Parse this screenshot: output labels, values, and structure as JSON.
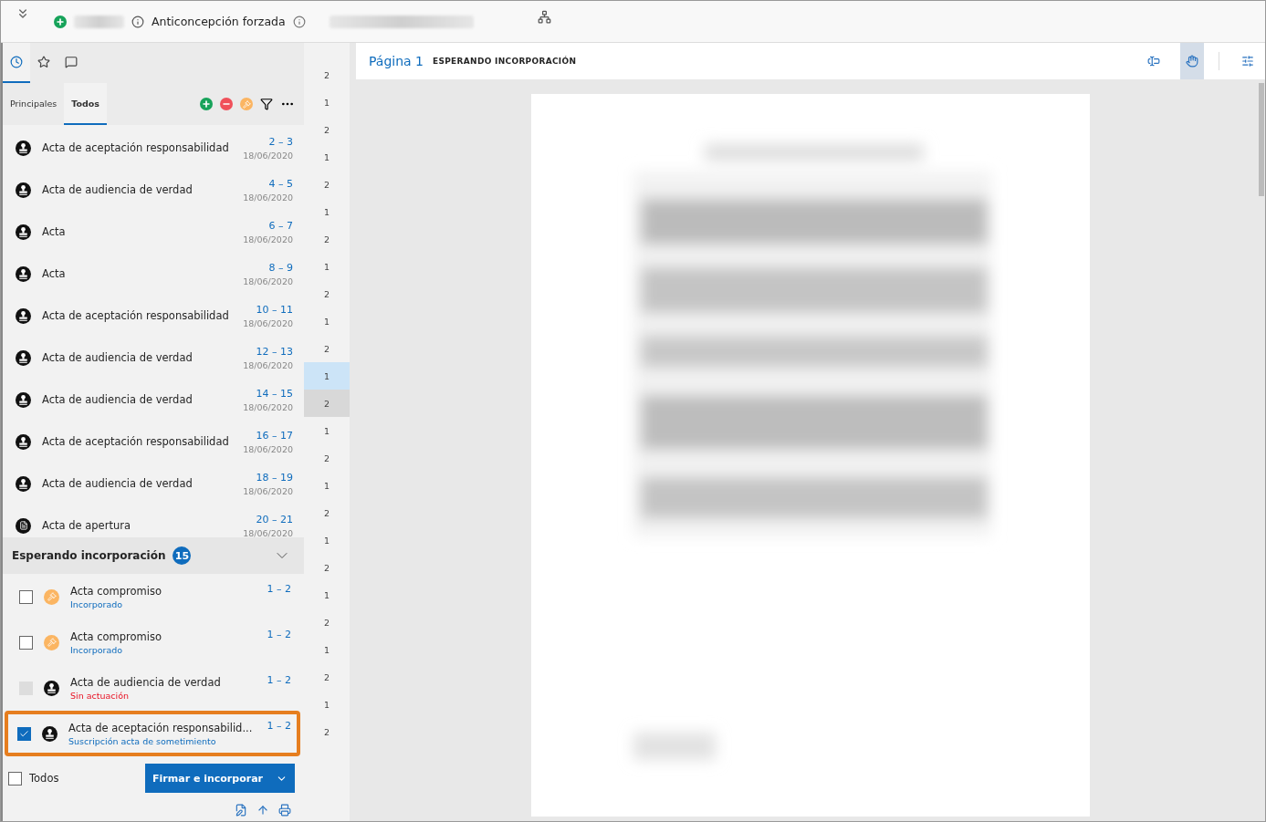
{
  "header": {
    "title": "Anticoncepción forzada"
  },
  "icon_tabs": [
    {
      "kind": "clock",
      "selected": true
    },
    {
      "kind": "star",
      "selected": false
    },
    {
      "kind": "comments",
      "selected": false
    }
  ],
  "sub_tabs": [
    {
      "label": "Principales",
      "selected": false
    },
    {
      "label": "Todos",
      "selected": true
    }
  ],
  "documents": [
    {
      "kind": "stamp",
      "title": "Acta de aceptación responsabilidad",
      "range": "2 – 3",
      "date": "18/06/2020"
    },
    {
      "kind": "stamp",
      "title": "Acta de audiencia de verdad",
      "range": "4 – 5",
      "date": "18/06/2020"
    },
    {
      "kind": "stamp",
      "title": "Acta",
      "range": "6 – 7",
      "date": "18/06/2020"
    },
    {
      "kind": "stamp",
      "title": "Acta",
      "range": "8 – 9",
      "date": "18/06/2020"
    },
    {
      "kind": "stamp",
      "title": "Acta de aceptación responsabilidad",
      "range": "10 – 11",
      "date": "18/06/2020"
    },
    {
      "kind": "stamp",
      "title": "Acta de audiencia de verdad",
      "range": "12 – 13",
      "date": "18/06/2020"
    },
    {
      "kind": "stamp",
      "title": "Acta de audiencia de verdad",
      "range": "14 – 15",
      "date": "18/06/2020"
    },
    {
      "kind": "stamp",
      "title": "Acta de aceptación responsabilidad",
      "range": "16 – 17",
      "date": "18/06/2020"
    },
    {
      "kind": "stamp",
      "title": "Acta de audiencia de verdad",
      "range": "18 – 19",
      "date": "18/06/2020"
    },
    {
      "kind": "document",
      "title": "Acta de apertura",
      "range": "20 – 21",
      "date": "18/06/2020"
    }
  ],
  "pending": {
    "title": "Esperando incorporación",
    "count": "15",
    "expanded": true,
    "items": [
      {
        "kind": "hammer",
        "title": "Acta compromiso",
        "status": "Incorporado",
        "error": false,
        "range": "1 – 2",
        "checked": false,
        "disabled": false,
        "selected": false
      },
      {
        "kind": "hammer",
        "title": "Acta compromiso",
        "status": "Incorporado",
        "error": false,
        "range": "1 – 2",
        "checked": false,
        "disabled": false,
        "selected": false
      },
      {
        "kind": "stamp",
        "title": "Acta de audiencia de verdad",
        "status": "Sin actuación",
        "error": true,
        "range": "1 – 2",
        "checked": false,
        "disabled": true,
        "selected": false
      },
      {
        "kind": "stamp",
        "title": "Acta de aceptación responsabilid...",
        "status": "Suscripción acta de sometimiento",
        "error": false,
        "range": "1 – 2",
        "checked": true,
        "disabled": false,
        "selected": true
      }
    ]
  },
  "select_all": {
    "label": "Todos",
    "checked": false
  },
  "primary_button": {
    "label": "Firmar e incorporar"
  },
  "page_strip": [
    {
      "label": "2",
      "selected": false,
      "hovered": false
    },
    {
      "label": "1",
      "selected": false,
      "hovered": false
    },
    {
      "label": "2",
      "selected": false,
      "hovered": false
    },
    {
      "label": "1",
      "selected": false,
      "hovered": false
    },
    {
      "label": "2",
      "selected": false,
      "hovered": false
    },
    {
      "label": "1",
      "selected": false,
      "hovered": false
    },
    {
      "label": "2",
      "selected": false,
      "hovered": false
    },
    {
      "label": "1",
      "selected": false,
      "hovered": false
    },
    {
      "label": "2",
      "selected": false,
      "hovered": false
    },
    {
      "label": "1",
      "selected": false,
      "hovered": false
    },
    {
      "label": "2",
      "selected": false,
      "hovered": false
    },
    {
      "label": "1",
      "selected": true,
      "hovered": false
    },
    {
      "label": "2",
      "selected": false,
      "hovered": true
    },
    {
      "label": "1",
      "selected": false,
      "hovered": false
    },
    {
      "label": "2",
      "selected": false,
      "hovered": false
    },
    {
      "label": "1",
      "selected": false,
      "hovered": false
    },
    {
      "label": "2",
      "selected": false,
      "hovered": false
    },
    {
      "label": "1",
      "selected": false,
      "hovered": false
    },
    {
      "label": "2",
      "selected": false,
      "hovered": false
    },
    {
      "label": "1",
      "selected": false,
      "hovered": false
    },
    {
      "label": "2",
      "selected": false,
      "hovered": false
    },
    {
      "label": "1",
      "selected": false,
      "hovered": false
    },
    {
      "label": "2",
      "selected": false,
      "hovered": false
    },
    {
      "label": "1",
      "selected": false,
      "hovered": false
    },
    {
      "label": "2",
      "selected": false,
      "hovered": false
    }
  ],
  "viewer": {
    "page_label": "Página 1",
    "status": "ESPERANDO INCORPORACIÓN",
    "tools": [
      {
        "kind": "text-select",
        "selected": false
      },
      {
        "kind": "hand",
        "selected": true
      },
      {
        "kind": "settings",
        "selected": false
      }
    ]
  }
}
